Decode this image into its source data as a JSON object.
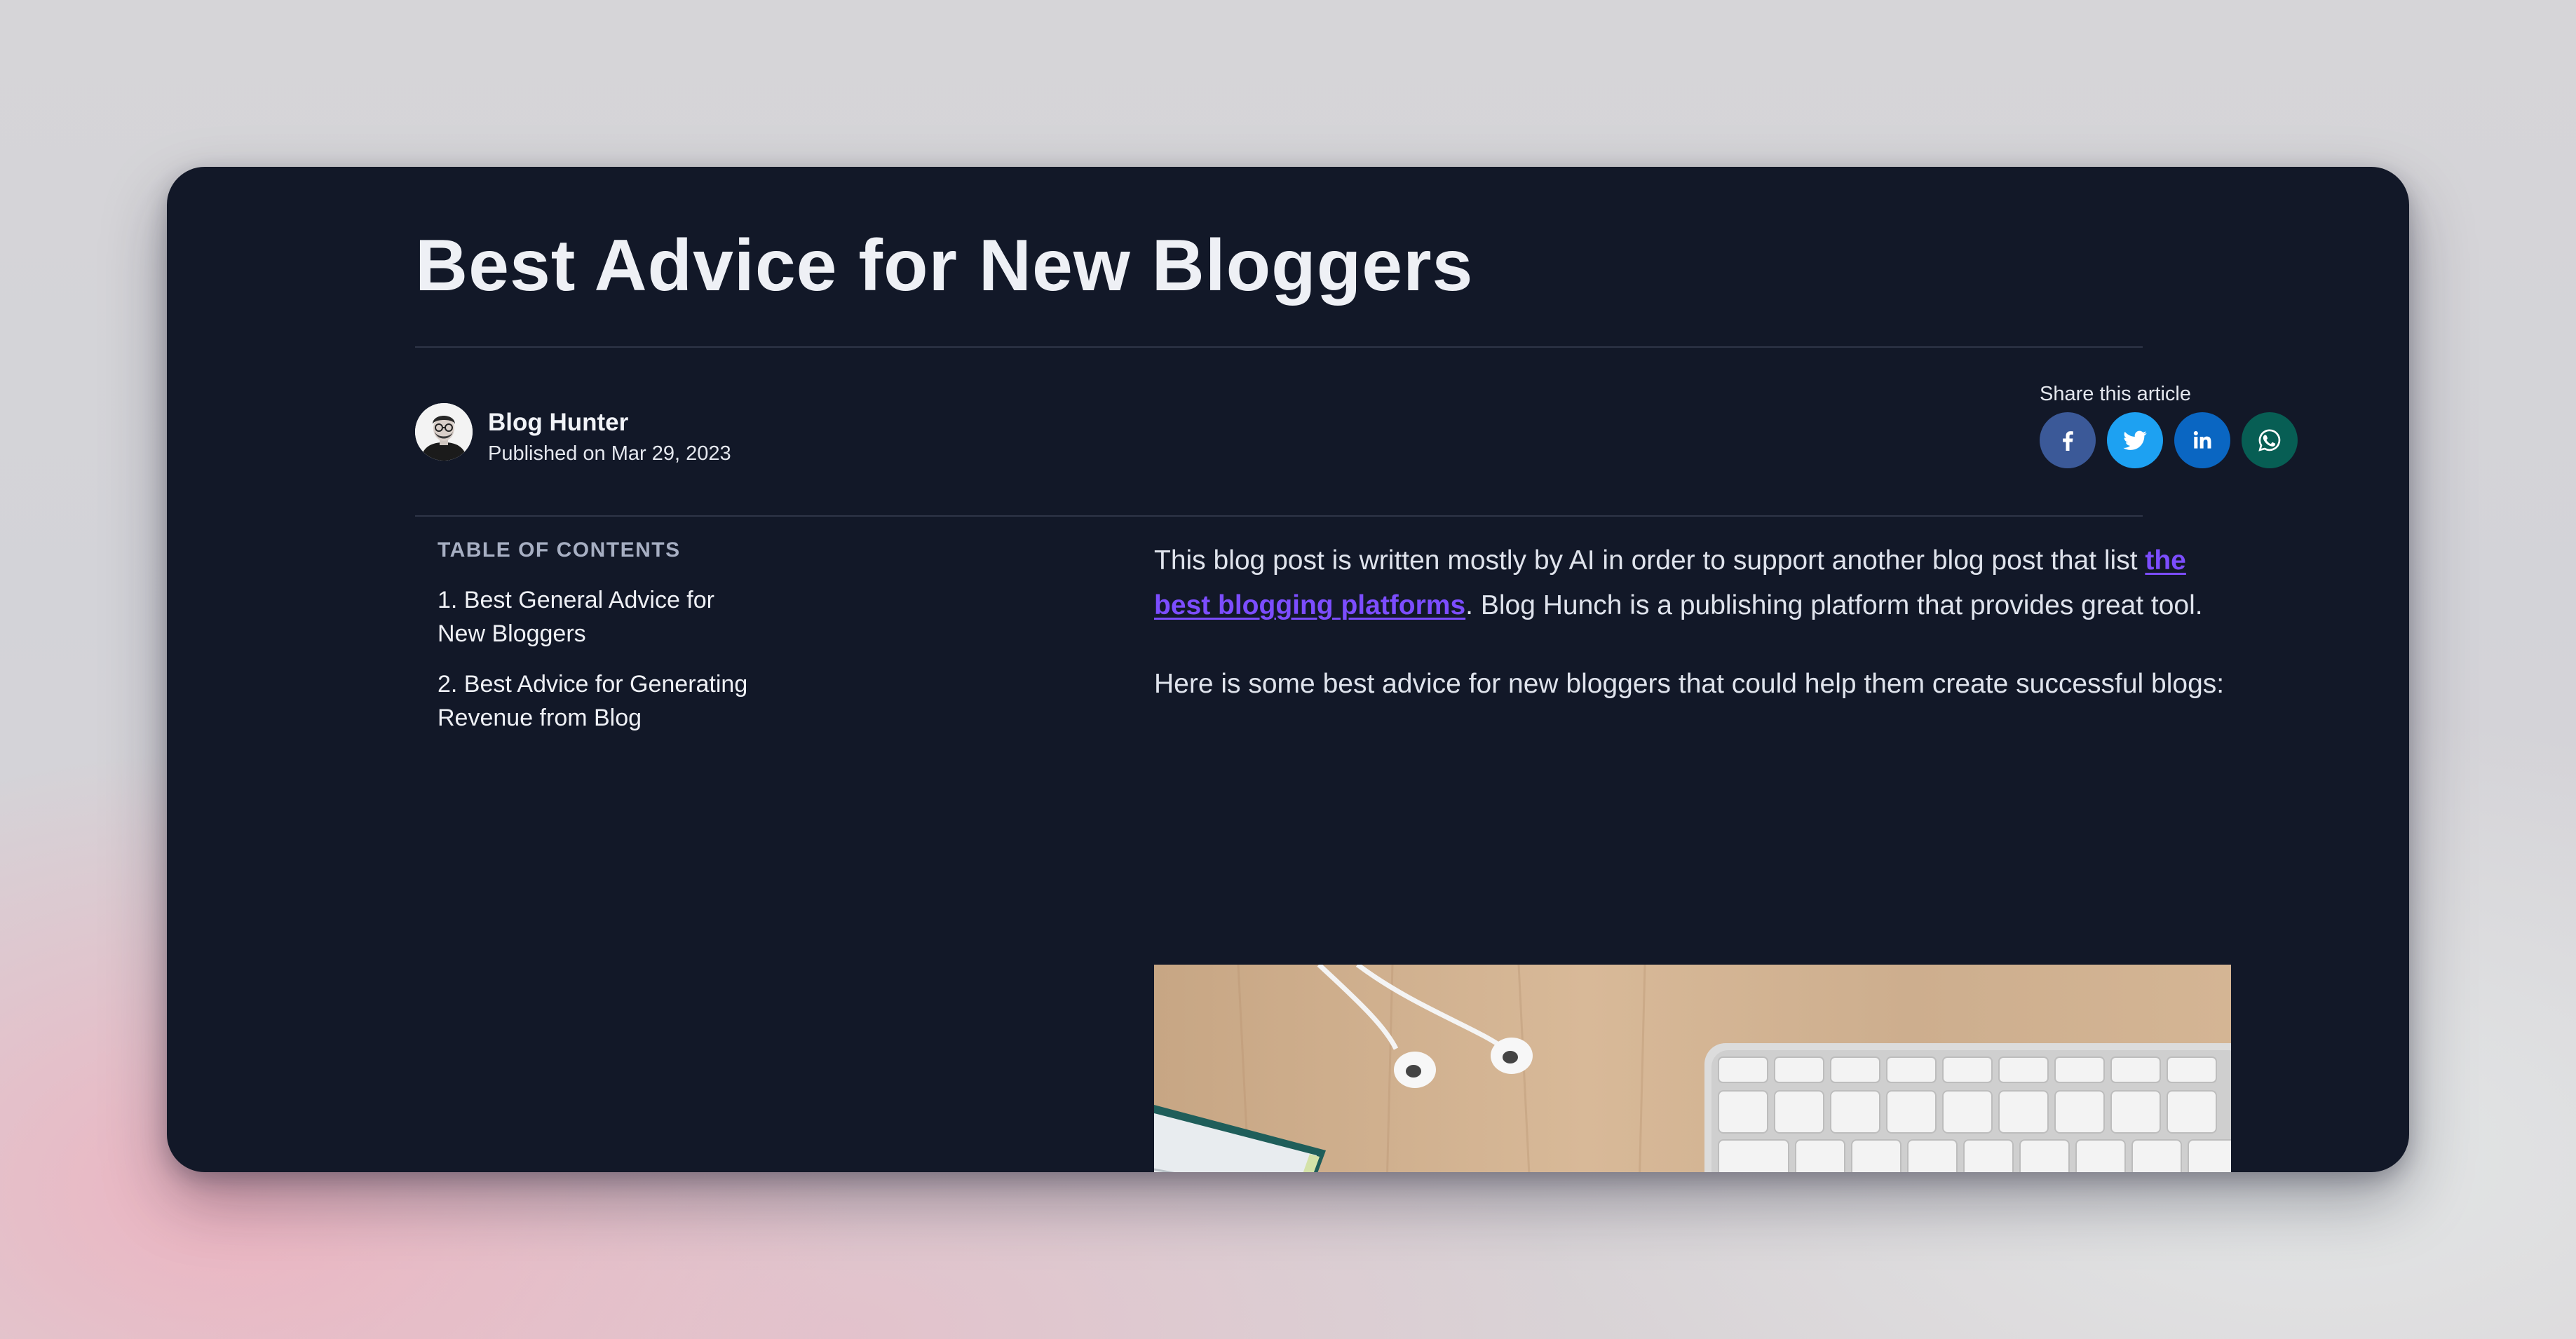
{
  "article": {
    "title": "Best Advice for New Bloggers",
    "author": {
      "name": "Blog Hunter",
      "published": "Published on Mar 29, 2023"
    },
    "share": {
      "label": "Share this article",
      "networks": [
        {
          "name": "facebook",
          "icon": "facebook-icon",
          "color": "#3b5998"
        },
        {
          "name": "twitter",
          "icon": "twitter-icon",
          "color": "#1da1f2"
        },
        {
          "name": "linkedin",
          "icon": "linkedin-icon",
          "color": "#0a66c2"
        },
        {
          "name": "whatsapp",
          "icon": "whatsapp-icon",
          "color": "#075e54"
        }
      ]
    },
    "toc": {
      "heading": "TABLE OF CONTENTS",
      "items": [
        "1. Best General Advice for New Bloggers",
        "2. Best Advice for Generating Revenue from Blog"
      ]
    },
    "body": {
      "p1_before": "This blog post is written mostly by AI in order to support another blog post that list ",
      "p1_link": "the best blogging platforms",
      "p1_after": ". Blog Hunch is a publishing platform that provides great tool.",
      "p2": "Here is some best advice for new bloggers that could help them create successful blogs:"
    }
  },
  "colors": {
    "card_bg": "#121828",
    "link": "#7c4dff",
    "toc_heading": "#a7afc3"
  }
}
